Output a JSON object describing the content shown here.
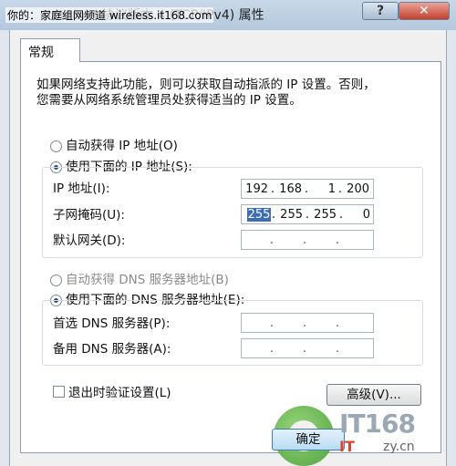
{
  "window": {
    "watermark": "你的：家庭组网频道 wireless.it168.com",
    "title": "Internet 协议版本 4 (TCP/IPv4) 属性",
    "help_label": "?",
    "close_label": "✕"
  },
  "tabs": [
    {
      "label": "常规"
    }
  ],
  "description": [
    "如果网络支持此功能，则可以获取自动指派的 IP 设置。否则，",
    "您需要从网络系统管理员处获得适当的 IP 设置。"
  ],
  "ip_section": {
    "auto_radio": "自动获得 IP 地址(O)",
    "manual_radio": "使用下面的 IP 地址(S):",
    "fields": [
      {
        "label": "IP 地址(I):",
        "octets": [
          "192",
          "168",
          "1",
          "200"
        ]
      },
      {
        "label": "子网掩码(U):",
        "octets": [
          "255",
          "255",
          "255",
          "0"
        ]
      },
      {
        "label": "默认网关(D):",
        "octets": [
          "",
          "",
          "",
          ""
        ]
      }
    ]
  },
  "dns_section": {
    "auto_radio": "自动获得 DNS 服务器地址(B)",
    "manual_radio": "使用下面的 DNS 服务器地址(E):",
    "fields": [
      {
        "label": "首选 DNS 服务器(P):",
        "octets": [
          "",
          "",
          "",
          ""
        ]
      },
      {
        "label": "备用 DNS 服务器(A):",
        "octets": [
          "",
          "",
          "",
          ""
        ]
      }
    ]
  },
  "validate_checkbox": "退出时验证设置(L)",
  "advanced_button": "高级(V)...",
  "ok_button": "确定",
  "brand": {
    "text_a": "IT168",
    "text_b": "IT",
    "text_c": "zy.cn"
  }
}
